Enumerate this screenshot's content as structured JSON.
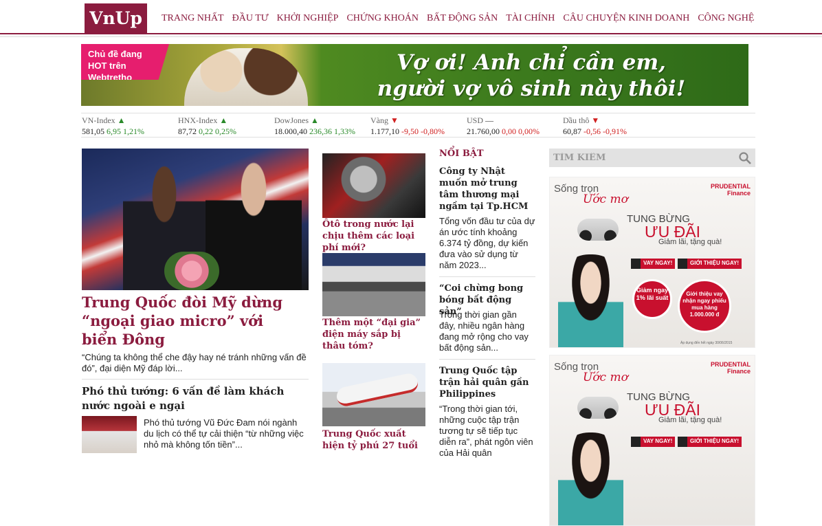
{
  "logo": "VnUp",
  "nav": [
    "TRANG NHẤT",
    "ĐẦU TƯ",
    "KHỞI NGHIỆP",
    "CHỨNG KHOÁN",
    "BẤT ĐỘNG SẢN",
    "TÀI CHÍNH",
    "CÂU CHUYỆN KINH DOANH",
    "CÔNG NGHỆ"
  ],
  "banner": {
    "hot_label": "Chủ đề đang HOT trên Webtretho",
    "slogan_line1": "Vợ ơi! Anh chỉ cần em,",
    "slogan_line2": "người vợ vô sinh này thôi!"
  },
  "ticker": [
    {
      "name": "VN-Index",
      "arrow": "▲",
      "dir": "up",
      "value": "581,05",
      "change": "6,95",
      "pct": "1,21%"
    },
    {
      "name": "HNX-Index",
      "arrow": "▲",
      "dir": "up",
      "value": "87,72",
      "change": "0,22",
      "pct": "0,25%"
    },
    {
      "name": "DowJones",
      "arrow": "▲",
      "dir": "up",
      "value": "18.000,40",
      "change": "236,36",
      "pct": "1,33%"
    },
    {
      "name": "Vàng",
      "arrow": "▼",
      "dir": "dn",
      "value": "1.177,10",
      "change": "-9,50",
      "pct": "-0,80%"
    },
    {
      "name": "USD",
      "arrow": "—",
      "dir": "eq",
      "value": "21.760,00",
      "change": "0,00",
      "pct": "0,00%"
    },
    {
      "name": "Dầu thô",
      "arrow": "▼",
      "dir": "dn",
      "value": "60,87",
      "change": "-0,56",
      "pct": "-0,91%"
    }
  ],
  "main": {
    "title": "Trung Quốc đòi Mỹ dừng “ngoại giao micro” với biển Đông",
    "summary": "“Chúng ta không thể che đậy hay né tránh những vấn đề đó”, đại diện Mỹ đáp lời...",
    "sub_title": "Phó thủ tướng: 6 vấn đề làm khách nước ngoài e ngại",
    "sub_summary": "Phó thủ tướng Vũ Đức Đam nói ngành du lịch có thể tự cải thiện “từ những việc nhỏ mà không tốn tiền”..."
  },
  "col2": [
    {
      "title": "Ôtô trong nước lại chịu thêm các loại phí mới?"
    },
    {
      "title": "Thêm một “đại gia” điện máy sắp bị thâu tóm?"
    },
    {
      "title": "Trung Quốc xuất hiện tỷ phú 27 tuổi"
    }
  ],
  "featured": {
    "label": "NỔI BẬT",
    "items": [
      {
        "title": "Công ty Nhật muốn mở trung tâm thương mại ngầm tại Tp.HCM",
        "summary": "Tổng vốn đầu tư của dự án ước tính khoảng 6.374 tỷ đồng, dự kiến đưa vào sử dụng từ năm 2023..."
      },
      {
        "title": "“Coi chừng bong bóng bất động sản”",
        "summary": "Trong thời gian gần đây, nhiều ngân hàng đang mở rộng cho vay bất động sản..."
      },
      {
        "title": "Trung Quốc tập trận hải quân gần Philippines",
        "summary": "“Trong thời gian tới, những cuộc tập trận tương tự sẽ tiếp tục diễn ra”, phát ngôn viên của Hải quân"
      }
    ]
  },
  "search": {
    "placeholder": "TÌM KIẾM"
  },
  "ad": {
    "s1": "Sống trọn",
    "s2": "Ước mơ",
    "brand1": "PRUDENTIAL",
    "brand2": "Finance",
    "tung": "TUNG BỪNG",
    "uu": "ƯU ĐÃI",
    "giam": "Giảm lãi, tặng quà!",
    "btn1": "VAY NGAY!",
    "btn2": "GIỚI THIỆU NGAY!",
    "c1": "Giảm ngay 1% lãi suất",
    "c2": "Giới thiệu vay nhận ngay phiếu mua hàng 1.000.000 đ",
    "note": "Áp dụng đến hết ngày 30/06/2015"
  }
}
